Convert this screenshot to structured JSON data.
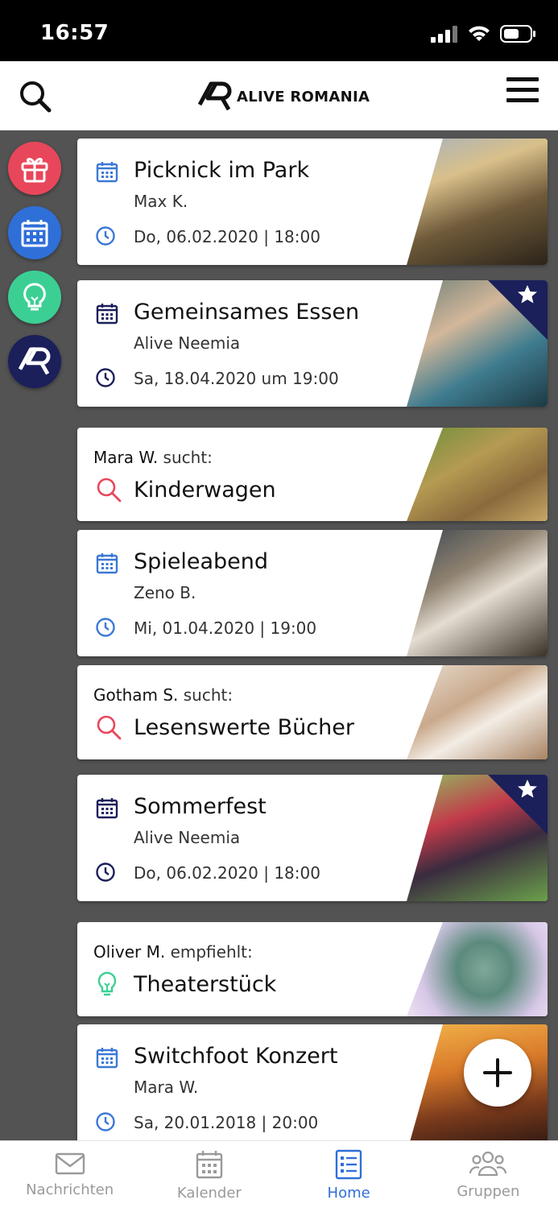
{
  "status_bar": {
    "time": "16:57"
  },
  "header": {
    "logo_text": "ALIVE ROMANIA"
  },
  "side_rail": {
    "items": [
      "gift-icon",
      "calendar-icon",
      "lightbulb-icon",
      "alive-logo-icon"
    ]
  },
  "feed": {
    "cards": [
      {
        "type": "event",
        "title": "Picknick im Park",
        "subtitle": "Max K.",
        "date": "Do, 06.02.2020 | 18:00",
        "icon_color": "#3b78d6"
      },
      {
        "type": "event",
        "title": "Gemeinsames Essen",
        "subtitle": "Alive Neemia",
        "date": "Sa, 18.04.2020 um 19:00",
        "icon_color": "#1b1f5a",
        "starred": true
      },
      {
        "type": "search",
        "person": "Mara W.",
        "verb": "sucht:",
        "title": "Kinderwagen"
      },
      {
        "type": "event",
        "title": "Spieleabend",
        "subtitle": "Zeno B.",
        "date": "Mi, 01.04.2020 | 19:00",
        "icon_color": "#3b78d6"
      },
      {
        "type": "search",
        "person": "Gotham S.",
        "verb": "sucht:",
        "title": "Lesenswerte Bücher"
      },
      {
        "type": "event",
        "title": "Sommerfest",
        "subtitle": "Alive Neemia",
        "date": "Do, 06.02.2020 | 18:00",
        "icon_color": "#1b1f5a",
        "starred": true
      },
      {
        "type": "recommend",
        "person": "Oliver M.",
        "verb": "empfiehlt:",
        "title": "Theaterstück"
      },
      {
        "type": "event",
        "title": "Switchfoot Konzert",
        "subtitle": "Mara W.",
        "date": "Sa, 20.01.2018 | 20:00",
        "icon_color": "#3b78d6"
      }
    ]
  },
  "tab_bar": {
    "tabs": [
      {
        "label": "Nachrichten",
        "icon": "mail-icon"
      },
      {
        "label": "Kalender",
        "icon": "calendar-icon"
      },
      {
        "label": "Home",
        "icon": "list-icon",
        "active": true
      },
      {
        "label": "Gruppen",
        "icon": "group-icon"
      }
    ]
  },
  "colors": {
    "accent_blue": "#2f6fd8",
    "navy": "#1b1f5a",
    "search_red": "#e8475b",
    "idea_green": "#3ccf94"
  }
}
